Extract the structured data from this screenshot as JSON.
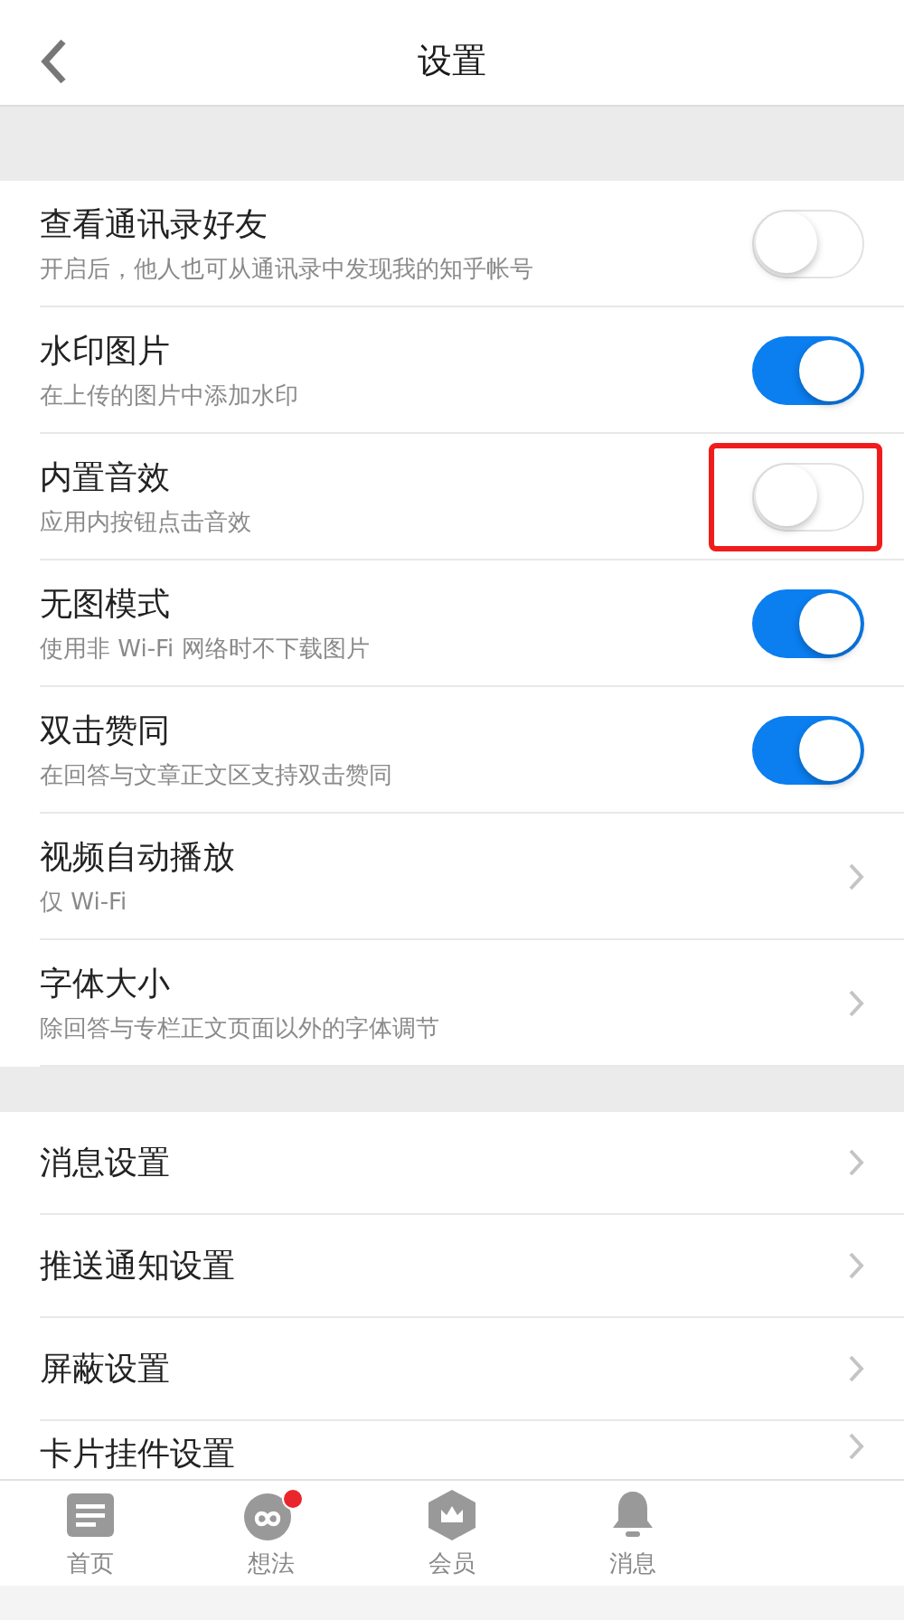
{
  "nav_bar": {
    "title": "设置"
  },
  "sections": [
    {
      "items": [
        {
          "kind": "toggle",
          "title": "查看通讯录好友",
          "subtitle": "开启后，他人也可从通讯录中发现我的知乎帐号",
          "on": false,
          "highlighted": false
        },
        {
          "kind": "toggle",
          "title": "水印图片",
          "subtitle": "在上传的图片中添加水印",
          "on": true,
          "highlighted": false
        },
        {
          "kind": "toggle",
          "title": "内置音效",
          "subtitle": "应用内按钮点击音效",
          "on": false,
          "highlighted": true
        },
        {
          "kind": "toggle",
          "title": "无图模式",
          "subtitle": "使用非 Wi-Fi 网络时不下载图片",
          "on": true,
          "highlighted": false
        },
        {
          "kind": "toggle",
          "title": "双击赞同",
          "subtitle": "在回答与文章正文区支持双击赞同",
          "on": true,
          "highlighted": false
        },
        {
          "kind": "link",
          "title": "视频自动播放",
          "subtitle": "仅 Wi-Fi"
        },
        {
          "kind": "link",
          "title": "字体大小",
          "subtitle": "除回答与专栏正文页面以外的字体调节"
        }
      ]
    },
    {
      "items": [
        {
          "kind": "link",
          "title": "消息设置"
        },
        {
          "kind": "link",
          "title": "推送通知设置"
        },
        {
          "kind": "link",
          "title": "屏蔽设置"
        },
        {
          "kind": "link",
          "title": "卡片挂件设置"
        }
      ]
    }
  ],
  "tab_bar": [
    {
      "kind": "home",
      "label": "首页",
      "badge": false
    },
    {
      "kind": "ideas",
      "label": "想法",
      "badge": true
    },
    {
      "kind": "vip",
      "label": "会员",
      "badge": false
    },
    {
      "kind": "bell",
      "label": "消息",
      "badge": false
    }
  ]
}
